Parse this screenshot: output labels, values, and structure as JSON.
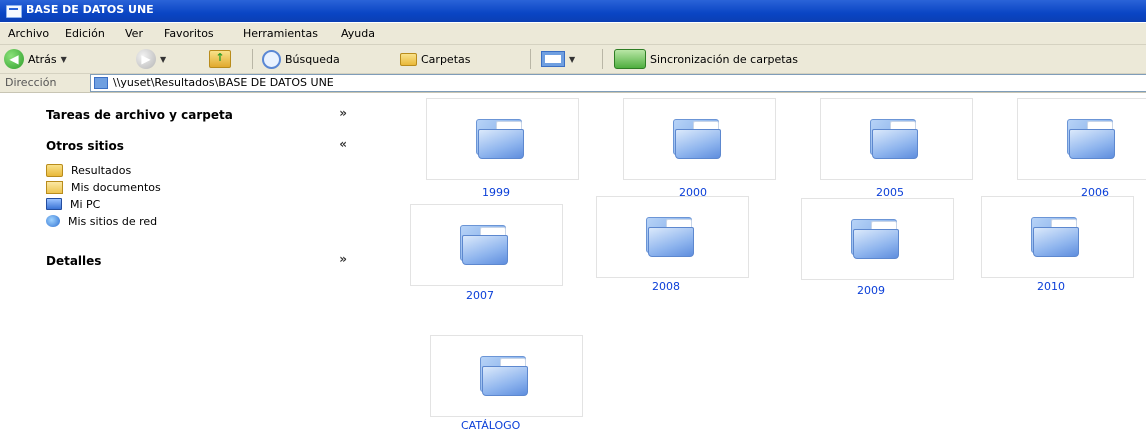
{
  "window": {
    "title": "BASE DE DATOS UNE"
  },
  "menu": [
    "Archivo",
    "Edición",
    "Ver",
    "Favoritos",
    "Herramientas",
    "Ayuda"
  ],
  "toolbar": {
    "back_label": "Atrás",
    "search_label": "Búsqueda",
    "folders_label": "Carpetas",
    "sync_label": "Sincronización de carpetas"
  },
  "address": {
    "label": "Dirección",
    "value": "\\\\yuset\\Resultados\\BASE DE DATOS UNE"
  },
  "sidebar": {
    "tasks_title": "Tareas de archivo y carpeta",
    "other_title": "Otros sitios",
    "other_items": [
      "Resultados",
      "Mis documentos",
      "Mi PC",
      "Mis sitios de red"
    ],
    "details_title": "Detalles"
  },
  "folders": [
    "1999",
    "2000",
    "2005",
    "2006",
    "2007",
    "2008",
    "2009",
    "2010",
    "CATÁLOGO"
  ]
}
